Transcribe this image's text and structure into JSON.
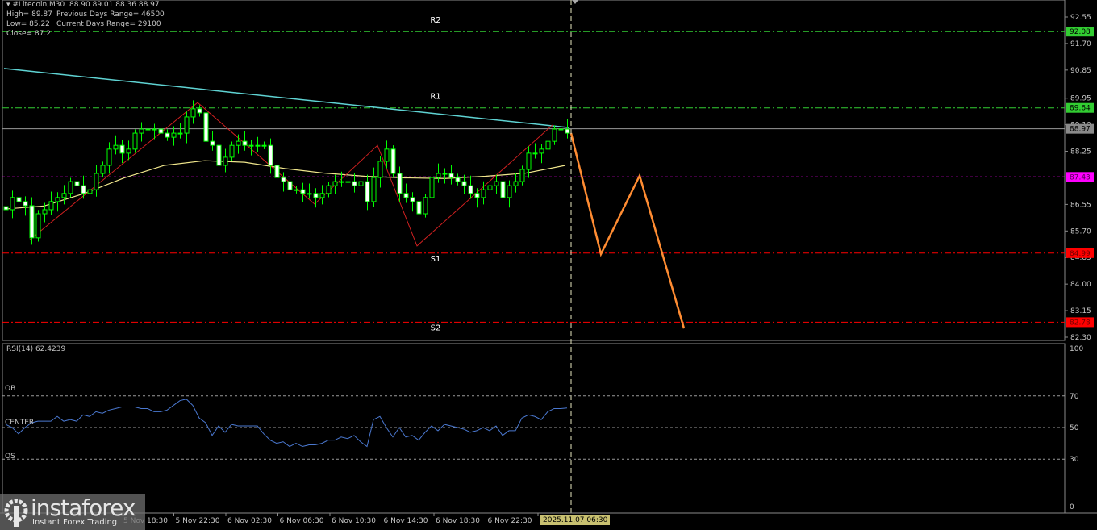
{
  "header": {
    "symbol_line": "#Litecoin,M30  88.90 89.01 88.36 88.97",
    "high": "High= 89.87",
    "low": "Low= 85.22",
    "close": "Close= 87.2",
    "prev_range": "Previous Days Range= 46500",
    "curr_range": "Current Days Range= 29100"
  },
  "rsi_label": "RSI(14) 62.4239",
  "rsi_levels": {
    "ob": "OB",
    "center": "CENTER",
    "os": "OS"
  },
  "cursor_time": "2025.11.07 06:30",
  "logo": {
    "name": "instaforex",
    "tagline": "Instant Forex Trading"
  },
  "colors": {
    "bull": "#00ff00",
    "body": "#ffffff",
    "ma_slow": "#5fd3d3",
    "ma_fast": "#f0e68c",
    "zigzag": "#d02020",
    "forecast": "#ff8c32",
    "rsi": "#4a78d0",
    "resistance": "#32cd32",
    "pivot": "#ff00ff",
    "support": "#ff0000"
  },
  "chart_data": {
    "type": "candlestick",
    "symbol": "#Litecoin",
    "timeframe": "M30",
    "ylim": [
      82.3,
      92.55
    ],
    "y_ticks": [
      "92.55",
      "91.70",
      "90.85",
      "89.95",
      "89.10",
      "88.25",
      "86.55",
      "85.70",
      "84.85",
      "84.00",
      "83.15",
      "82.30"
    ],
    "x_ticks": [
      "5 Nov 18:30",
      "5 Nov 22:30",
      "6 Nov 02:30",
      "6 Nov 06:30",
      "6 Nov 10:30",
      "6 Nov 14:30",
      "6 Nov 18:30",
      "6 Nov 22:30",
      "7 Nov 02:30"
    ],
    "closes": [
      86.38,
      86.77,
      86.64,
      86.51,
      85.48,
      86.25,
      86.38,
      86.64,
      86.77,
      86.9,
      87.28,
      87.15,
      86.9,
      87.02,
      87.54,
      87.8,
      88.32,
      88.44,
      88.19,
      88.32,
      88.83,
      88.96,
      88.96,
      88.96,
      88.83,
      88.7,
      88.83,
      88.83,
      89.35,
      89.61,
      89.48,
      88.57,
      88.44,
      87.8,
      88.06,
      88.44,
      88.57,
      88.44,
      88.44,
      88.44,
      88.44,
      87.8,
      87.41,
      87.28,
      87.02,
      87.02,
      86.9,
      86.9,
      86.77,
      86.9,
      87.15,
      87.28,
      87.28,
      87.28,
      87.15,
      87.28,
      86.64,
      87.41,
      87.93,
      88.32,
      87.54,
      86.9,
      86.77,
      86.64,
      86.25,
      86.77,
      87.41,
      87.54,
      87.54,
      87.41,
      87.28,
      87.15,
      86.9,
      86.77,
      87.02,
      87.15,
      87.28,
      86.77,
      87.15,
      87.28,
      87.67,
      88.19,
      88.19,
      88.32,
      88.57,
      88.96,
      88.96,
      88.83
    ],
    "ma_slow": [
      90.9,
      89.01
    ],
    "ma_fast": [
      86.4,
      86.5,
      86.9,
      87.4,
      87.8,
      87.95,
      87.9,
      87.7,
      87.55,
      87.45,
      87.4,
      87.38,
      87.45,
      87.55,
      87.8
    ],
    "zigzag": [
      85.42,
      89.81,
      86.56,
      88.44,
      85.22,
      89.09
    ],
    "forecast": [
      88.83,
      84.96,
      87.47,
      82.58
    ],
    "levels": [
      {
        "name": "R2",
        "value": 92.08,
        "label": "92.08",
        "kind": "resistance"
      },
      {
        "name": "R1",
        "value": 89.64,
        "label": "89.64",
        "kind": "resistance"
      },
      {
        "name": "",
        "value": 88.97,
        "label": "88.97",
        "kind": "current"
      },
      {
        "name": "",
        "value": 87.43,
        "label": "87.43",
        "kind": "pivot"
      },
      {
        "name": "S1",
        "value": 84.99,
        "label": "84.99",
        "kind": "support"
      },
      {
        "name": "S2",
        "value": 82.78,
        "label": "82.78",
        "kind": "support"
      }
    ],
    "rsi": {
      "period": 14,
      "ylim": [
        0,
        100
      ],
      "ticks": [
        "100",
        "70",
        "50",
        "30",
        "0"
      ],
      "levels": [
        70,
        50,
        30
      ],
      "values": [
        52,
        50,
        46,
        50,
        53,
        54,
        54,
        54,
        57,
        54,
        55,
        54,
        58,
        57,
        60,
        59,
        61,
        62,
        63,
        63,
        63,
        62,
        62,
        60,
        60,
        61,
        64,
        67,
        68,
        64,
        56,
        53,
        45,
        51,
        47,
        52,
        51,
        51,
        51,
        51,
        46,
        42,
        40,
        41,
        38,
        40,
        38,
        39,
        39,
        40,
        42,
        42,
        44,
        43,
        45,
        41,
        38,
        55,
        57,
        50,
        44,
        50,
        44,
        45,
        42,
        47,
        51,
        48,
        52,
        51,
        50,
        49,
        47,
        48,
        50,
        48,
        51,
        45,
        48,
        48,
        56,
        58,
        57,
        55,
        60,
        62,
        62,
        62.4
      ]
    }
  }
}
